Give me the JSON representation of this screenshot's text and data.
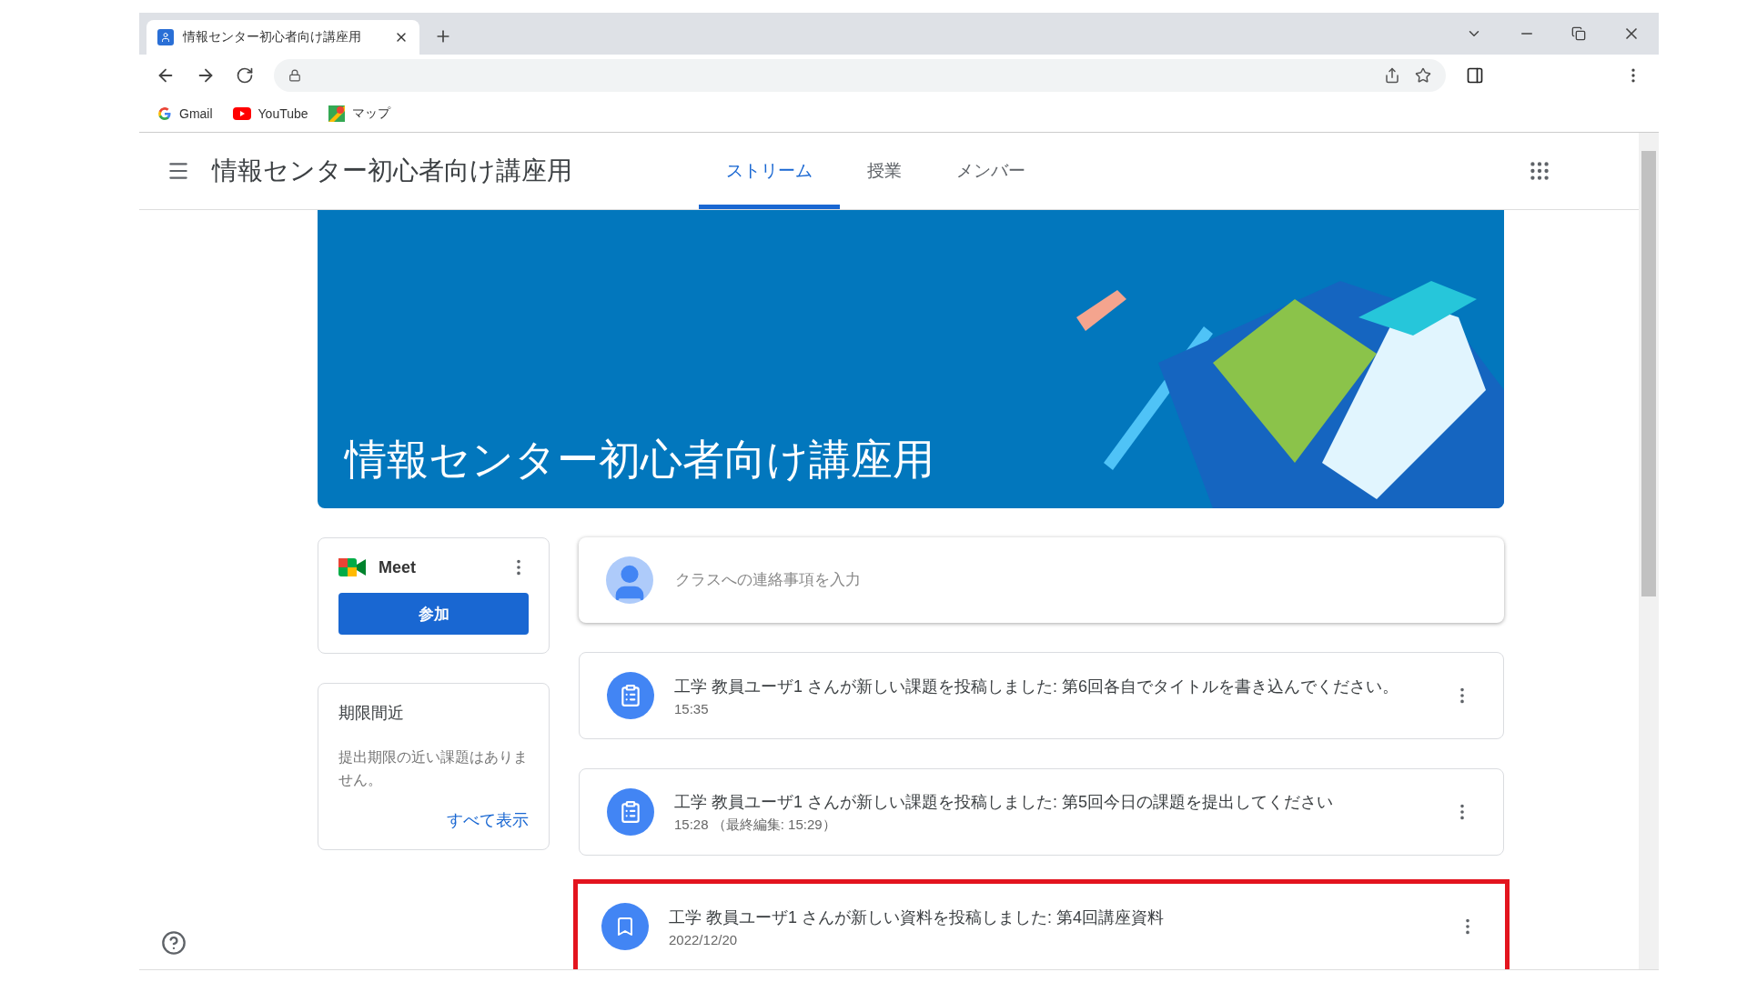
{
  "browser": {
    "tab_title": "情報センター初心者向け講座用",
    "bookmarks": [
      {
        "kind": "google",
        "label": "Gmail"
      },
      {
        "kind": "youtube",
        "label": "YouTube"
      },
      {
        "kind": "maps",
        "label": "マップ"
      }
    ]
  },
  "header": {
    "title": "情報センター初心者向け講座用",
    "tabs": [
      {
        "label": "ストリーム",
        "selected": true
      },
      {
        "label": "授業",
        "selected": false
      },
      {
        "label": "メンバー",
        "selected": false
      }
    ]
  },
  "banner": {
    "title": "情報センター初心者向け講座用"
  },
  "meet": {
    "label": "Meet",
    "join_button": "参加"
  },
  "upcoming": {
    "title": "期限間近",
    "message": "提出期限の近い課題はありません。",
    "link": "すべて表示"
  },
  "compose": {
    "placeholder": "クラスへの連絡事項を入力"
  },
  "posts": [
    {
      "kind": "assignment",
      "text": "工学 教員ユーザ1 さんが新しい課題を投稿しました: 第6回各自でタイトルを書き込んでください。",
      "time": "15:35",
      "highlighted": false
    },
    {
      "kind": "assignment",
      "text": "工学 教員ユーザ1 さんが新しい課題を投稿しました: 第5回今日の課題を提出してください",
      "time": "15:28 （最終編集: 15:29）",
      "highlighted": false
    },
    {
      "kind": "material",
      "text": "工学 教員ユーザ1 さんが新しい資料を投稿しました: 第4回講座資料",
      "time": "2022/12/20",
      "highlighted": true
    }
  ]
}
